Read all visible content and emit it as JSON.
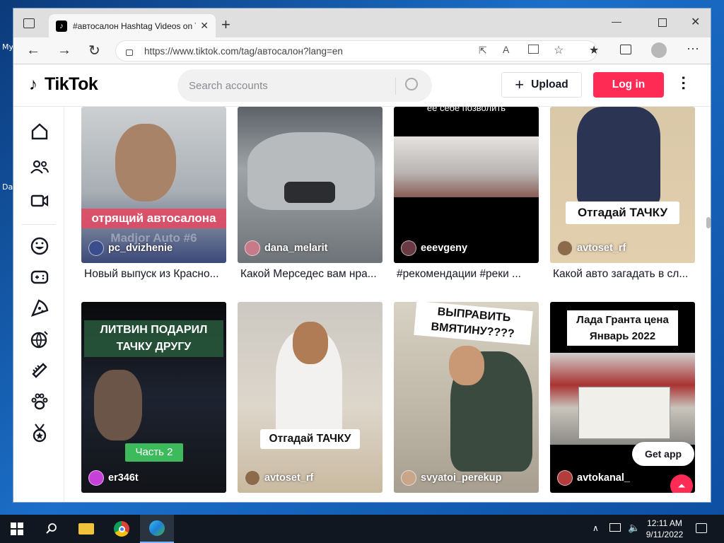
{
  "browser": {
    "tab_title": "#автосалон Hashtag Videos on T",
    "url": "https://www.tiktok.com/tag/автосалон?lang=en"
  },
  "desktop": {
    "labels": [
      "My",
      "Da"
    ]
  },
  "header": {
    "logo_text": "TikTok",
    "search_placeholder": "Search accounts",
    "upload_label": "Upload",
    "login_label": "Log in"
  },
  "sidebar": {
    "icons": [
      "home-icon",
      "following-icon",
      "live-icon",
      "comedy-icon",
      "gaming-icon",
      "food-icon",
      "travel-icon",
      "beauty-icon",
      "animals-icon",
      "sports-icon"
    ]
  },
  "videos": [
    {
      "user": "pc_dvizhenie",
      "caption": "Новый выпуск из Красно...",
      "overlay": "отрящий автосалона",
      "overlay2": "Madjor Auto #6"
    },
    {
      "user": "dana_melarit",
      "caption": "Какой Мерседес вам нра..."
    },
    {
      "user": "eeevgeny",
      "caption": "#рекомендации #реки ...",
      "overlay": "ее себе позволить"
    },
    {
      "user": "avtoset_rf",
      "caption": "Какой авто загадать в сл...",
      "overlay": "Отгадай ТАЧКУ"
    },
    {
      "user": "er346t",
      "overlay": "ЛИТВИН ПОДАРИЛ ТАЧКУ ДРУГУ",
      "overlay2": "Часть 2"
    },
    {
      "user": "avtoset_rf",
      "overlay": "Отгадай ТАЧКУ"
    },
    {
      "user": "svyatoi_perekup",
      "overlay": "ВЫПРАВИТЬ ВМЯТИНУ????"
    },
    {
      "user": "avtokanal_",
      "overlay": "Лада Гранта цена Январь 2022"
    }
  ],
  "get_app_label": "Get app",
  "taskbar": {
    "time": "12:11 AM",
    "date": "9/11/2022"
  }
}
